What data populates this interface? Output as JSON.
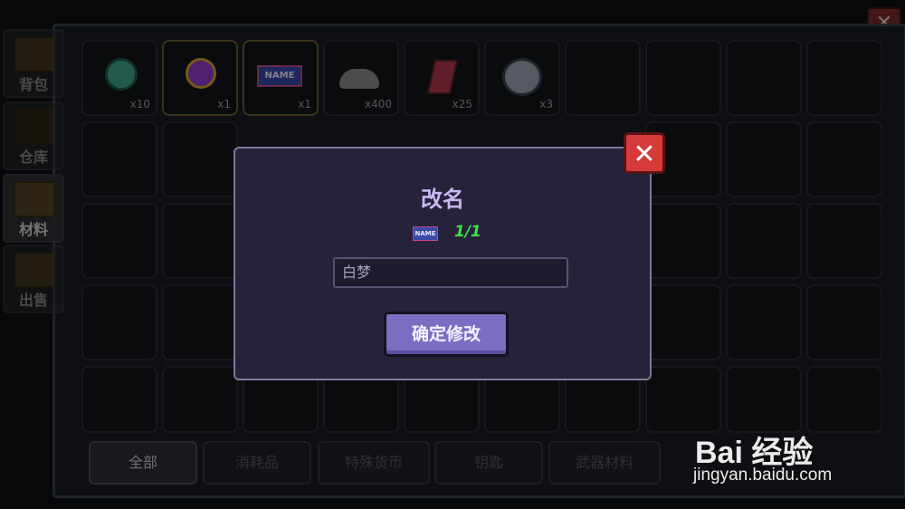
{
  "sidebar": {
    "tabs": [
      {
        "label": "背包"
      },
      {
        "label": "仓库"
      },
      {
        "label": "材料"
      },
      {
        "label": "出售"
      }
    ]
  },
  "inventory": {
    "items": [
      {
        "name": "green-gem-icon",
        "count": "x10",
        "color": "#3fa68a"
      },
      {
        "name": "purple-coin-icon",
        "count": "x1",
        "color": "#8e3ec9"
      },
      {
        "name": "name-card-icon",
        "count": "x1",
        "color": "#3a4aa8"
      },
      {
        "name": "ore-pile-icon",
        "count": "x400",
        "color": "#8a8a8a"
      },
      {
        "name": "red-crystal-icon",
        "count": "x25",
        "color": "#b03a4a"
      },
      {
        "name": "robot-head-icon",
        "count": "x3",
        "color": "#9aa4b0"
      }
    ]
  },
  "filters": [
    {
      "label": "全部"
    },
    {
      "label": "消耗品"
    },
    {
      "label": "特殊货币"
    },
    {
      "label": "钥匙"
    },
    {
      "label": "武器材料"
    }
  ],
  "dialog": {
    "title": "改名",
    "icon_text": "NAME",
    "count": "1/1",
    "input_value": "白梦",
    "confirm_label": "确定修改",
    "close_symbol": "✕"
  },
  "window": {
    "close_symbol": "✕"
  },
  "watermark": {
    "logo": "Bai 经验",
    "url": "jingyan.baidu.com"
  }
}
